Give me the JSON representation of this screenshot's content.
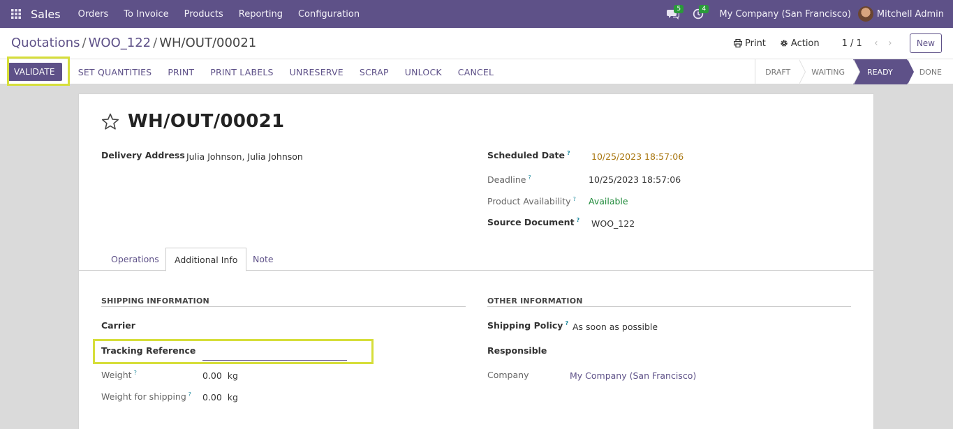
{
  "topnav": {
    "app_name": "Sales",
    "menu": [
      "Orders",
      "To Invoice",
      "Products",
      "Reporting",
      "Configuration"
    ],
    "messages_count": "5",
    "activities_count": "4",
    "company": "My Company (San Francisco)",
    "user": "Mitchell Admin"
  },
  "breadcrumb": {
    "items": [
      "Quotations",
      "WOO_122"
    ],
    "current": "WH/OUT/00021",
    "separator": "/"
  },
  "control": {
    "print_label": "Print",
    "action_label": "Action",
    "pager": "1 / 1",
    "new_label": "New"
  },
  "actions": {
    "validate": "VALIDATE",
    "buttons": [
      "SET QUANTITIES",
      "PRINT",
      "PRINT LABELS",
      "UNRESERVE",
      "SCRAP",
      "UNLOCK",
      "CANCEL"
    ]
  },
  "stages": {
    "items": [
      "DRAFT",
      "WAITING",
      "READY",
      "DONE"
    ],
    "active": "READY"
  },
  "record": {
    "title": "WH/OUT/00021",
    "delivery_address_label": "Delivery Address",
    "delivery_address": "Julia Johnson, Julia Johnson",
    "scheduled_date_label": "Scheduled Date",
    "scheduled_date": "10/25/2023 18:57:06",
    "deadline_label": "Deadline",
    "deadline": "10/25/2023 18:57:06",
    "availability_label": "Product Availability",
    "availability": "Available",
    "source_document_label": "Source Document",
    "source_document": "WOO_122",
    "help_mark": "?"
  },
  "tabs": [
    "Operations",
    "Additional Info",
    "Note"
  ],
  "shipping": {
    "section_title": "SHIPPING INFORMATION",
    "carrier_label": "Carrier",
    "tracking_label": "Tracking Reference",
    "tracking_value": "",
    "weight_label": "Weight",
    "weight": "0.00",
    "weight_unit": "kg",
    "weight_shipping_label": "Weight for shipping",
    "weight_shipping": "0.00",
    "weight_shipping_unit": "kg"
  },
  "other": {
    "section_title": "OTHER INFORMATION",
    "shipping_policy_label": "Shipping Policy",
    "shipping_policy": "As soon as possible",
    "responsible_label": "Responsible",
    "company_label": "Company",
    "company": "My Company (San Francisco)"
  },
  "colors": {
    "brand": "#5e5188",
    "highlight": "#d6de3a",
    "warning_date": "#a8750d",
    "available": "#1f8a3a"
  }
}
